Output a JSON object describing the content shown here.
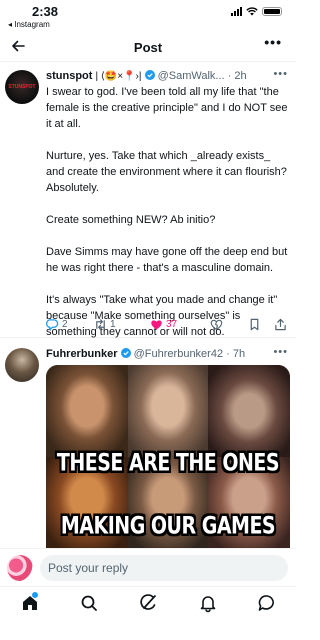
{
  "status_bar": {
    "time": "2:38",
    "back_label": "◂ Instagram"
  },
  "header": {
    "title": "Post",
    "more": "•••"
  },
  "post1": {
    "name": "stunspot",
    "emoji_bio": "| ⟨🤩×📍›|",
    "handle": "@SamWalk...",
    "time": "· 2h",
    "avatar_text": "STUNSPOT",
    "paragraphs": [
      "I swear to god. I've been told all my life that \"the female is the creative principle\" and I do NOT see it at all.",
      "Nurture, yes. Take that which _already exists_ and create the environment where it can flourish? Absolutely.",
      "Create something NEW? Ab initio?",
      "Dave Simms may have gone off the deep end but he was right there - that's a masculine domain.",
      "It's always \"Take what you made and change it\" because \"Make something ourselves\" is something they cannot or will not do."
    ],
    "replies": "2",
    "reposts": "1",
    "likes": "37"
  },
  "post2": {
    "name": "Fuhrerbunker",
    "handle": "@Fuhrerbunker42",
    "time": "· 7h",
    "meme_top": "THESE ARE THE ONES",
    "meme_bottom": "MAKING OUR GAMES"
  },
  "reply": {
    "placeholder": "Post your reply"
  },
  "colors": {
    "accent": "#1d9bf0",
    "like": "#f91880",
    "muted": "#536471"
  }
}
